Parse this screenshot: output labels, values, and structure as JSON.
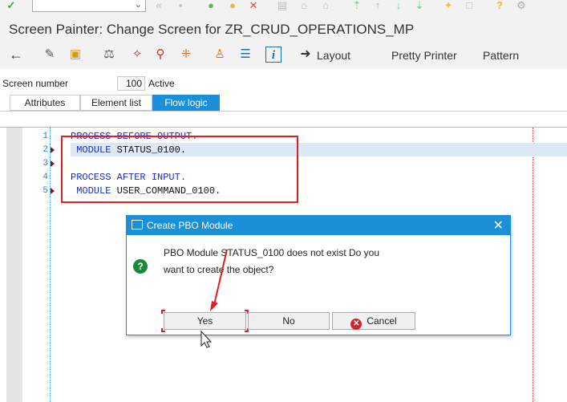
{
  "window": {
    "title": "Screen Painter: Change Screen for ZR_CRUD_OPERATIONS_MP"
  },
  "system_toolbar": {
    "command_field_value": "",
    "icons": [
      "check-icon",
      "back-icon",
      "exit-icon",
      "cancel-icon",
      "save-icon",
      "print-icon",
      "find-icon",
      "find-next-icon",
      "first-page-icon",
      "prev-page-icon",
      "next-page-icon",
      "last-page-icon",
      "new-session-icon",
      "shortcut-icon",
      "help-icon",
      "settings-icon"
    ]
  },
  "app_toolbar": {
    "layout_label": "Layout",
    "pretty_printer_label": "Pretty Printer",
    "pattern_label": "Pattern",
    "icons": [
      "back-arrow-icon",
      "display-change-icon",
      "other-object-icon",
      "check-syntax-icon",
      "activate-icon",
      "test-icon",
      "where-used-icon",
      "object-list-icon",
      "navigation-window-icon",
      "info-icon"
    ]
  },
  "screen": {
    "number_label": "Screen number",
    "number_value": "100",
    "status": "Active"
  },
  "tabs": [
    {
      "label": "Attributes",
      "active": false
    },
    {
      "label": "Element list",
      "active": false
    },
    {
      "label": "Flow logic",
      "active": true
    }
  ],
  "editor": {
    "lines": [
      {
        "num": "1",
        "keyword": "PROCESS BEFORE OUTPUT.",
        "rest": "",
        "marker": false
      },
      {
        "num": "2",
        "keyword": " MODULE",
        "rest": " STATUS_0100.",
        "marker": true
      },
      {
        "num": "3",
        "keyword": "",
        "rest": "",
        "marker": true
      },
      {
        "num": "4",
        "keyword": "PROCESS AFTER INPUT.",
        "rest": "",
        "marker": false
      },
      {
        "num": "5",
        "keyword": " MODULE",
        "rest": " USER_COMMAND_0100.",
        "marker": true
      }
    ]
  },
  "dialog": {
    "title": "Create PBO Module",
    "message_line1": "PBO Module STATUS_0100 does not exist Do you",
    "message_line2": "want to create the object?",
    "yes_label": "Yes",
    "no_label": "No",
    "cancel_label": "Cancel"
  },
  "colors": {
    "accent": "#1b8fd8",
    "keyword": "#1a2ed0",
    "annotation_red": "#e02020"
  }
}
